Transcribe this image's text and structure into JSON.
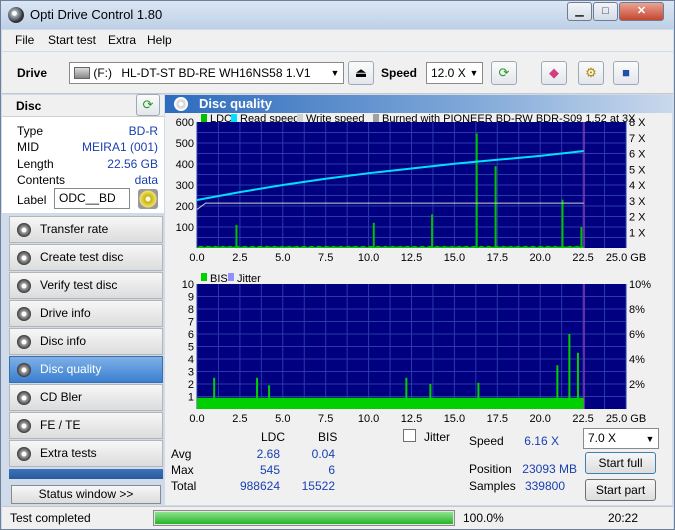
{
  "window": {
    "title": "Opti Drive Control 1.80",
    "min_label": "▁",
    "max_label": "□",
    "close_label": "✕"
  },
  "menu": [
    "File",
    "Start test",
    "Extra",
    "Help"
  ],
  "toolbar": {
    "drive_label": "Drive",
    "drive_letter": "(F:)",
    "drive_value": "HL-DT-ST BD-RE  WH16NS58 1.V1",
    "speed_label": "Speed",
    "speed_value": "12.0 X"
  },
  "disc": {
    "heading": "Disc",
    "fields": [
      {
        "label": "Type",
        "value": "BD-R"
      },
      {
        "label": "MID",
        "value": "MEIRA1 (001)"
      },
      {
        "label": "Length",
        "value": "22.56 GB"
      },
      {
        "label": "Contents",
        "value": "data"
      }
    ],
    "label_label": "Label",
    "label_value": "ODC__BD"
  },
  "nav": [
    "Transfer rate",
    "Create test disc",
    "Verify test disc",
    "Drive info",
    "Disc info",
    "Disc quality",
    "CD Bler",
    "FE / TE",
    "Extra tests"
  ],
  "nav_active": "Disc quality",
  "status_window_label": "Status window >>",
  "panel": {
    "title": "Disc quality"
  },
  "chart_data": [
    {
      "type": "line",
      "legend": [
        "LDC",
        "Read speed",
        "Write speed",
        "Burned with PIONEER BD-RW   BDR-S09 1.52 at 3X"
      ],
      "x_ticks": [
        "0.0",
        "2.5",
        "5.0",
        "7.5",
        "10.0",
        "12.5",
        "15.0",
        "17.5",
        "20.0",
        "22.5",
        "25.0 GB"
      ],
      "y_ticks": [
        "600",
        "500",
        "400",
        "300",
        "200",
        "100"
      ],
      "y2_ticks": [
        "8 X",
        "7 X",
        "6 X",
        "5 X",
        "4 X",
        "3 X",
        "2 X",
        "1 X"
      ],
      "xlim": [
        0,
        25
      ],
      "ylim": [
        0,
        600
      ],
      "y2lim": [
        0,
        8
      ],
      "read_speed": [
        [
          0,
          3.05
        ],
        [
          2.5,
          3.55
        ],
        [
          5,
          4.0
        ],
        [
          7.5,
          4.4
        ],
        [
          10,
          4.75
        ],
        [
          12.5,
          5.05
        ],
        [
          15,
          5.35
        ],
        [
          17.5,
          5.6
        ],
        [
          20,
          5.85
        ],
        [
          22.56,
          6.16
        ]
      ],
      "write_speed": [
        [
          0,
          2.45
        ],
        [
          0.5,
          2.85
        ],
        [
          22.56,
          2.85
        ]
      ],
      "ldc_spikes": [
        [
          16.3,
          545
        ],
        [
          17.4,
          390
        ],
        [
          21.3,
          230
        ],
        [
          13.7,
          160
        ],
        [
          10.3,
          120
        ],
        [
          2.3,
          110
        ],
        [
          22.4,
          100
        ]
      ],
      "colors": {
        "ldc": "#00c000",
        "read": "#00e0ff",
        "write": "#d0d0d0",
        "burned": "#a0a0a0"
      }
    },
    {
      "type": "bar",
      "legend": [
        "BIS",
        "Jitter"
      ],
      "x_ticks": [
        "0.0",
        "2.5",
        "5.0",
        "7.5",
        "10.0",
        "12.5",
        "15.0",
        "17.5",
        "20.0",
        "22.5",
        "25.0 GB"
      ],
      "y_ticks": [
        "10",
        "9",
        "8",
        "7",
        "6",
        "5",
        "4",
        "3",
        "2",
        "1"
      ],
      "y2_ticks": [
        "10%",
        "8%",
        "6%",
        "4%",
        "2%"
      ],
      "xlim": [
        0,
        25
      ],
      "ylim": [
        0,
        10
      ],
      "bis_spikes": [
        [
          21.7,
          6
        ],
        [
          22.2,
          4.5
        ],
        [
          21.0,
          3.5
        ],
        [
          1.0,
          2.5
        ],
        [
          3.5,
          2.5
        ],
        [
          12.2,
          2.5
        ],
        [
          4.2,
          1.9
        ],
        [
          13.6,
          2.0
        ],
        [
          16.4,
          2.1
        ]
      ],
      "colors": {
        "bis": "#00d000",
        "jitter": "#9090ff"
      }
    }
  ],
  "stats": {
    "col_ldc": "LDC",
    "col_bis": "BIS",
    "rows": [
      {
        "label": "Avg",
        "ldc": "2.68",
        "bis": "0.04"
      },
      {
        "label": "Max",
        "ldc": "545",
        "bis": "6"
      },
      {
        "label": "Total",
        "ldc": "988624",
        "bis": "15522"
      }
    ],
    "jitter_label": "Jitter",
    "speed_label": "Speed",
    "speed_value": "6.16 X",
    "position_label": "Position",
    "position_value": "23093 MB",
    "samples_label": "Samples",
    "samples_value": "339800",
    "speed_select": "7.0 X",
    "start_full": "Start full",
    "start_part": "Start part"
  },
  "statusbar": {
    "text": "Test completed",
    "progress_pct": 100,
    "progress_text": "100.0%",
    "time": "20:22"
  }
}
